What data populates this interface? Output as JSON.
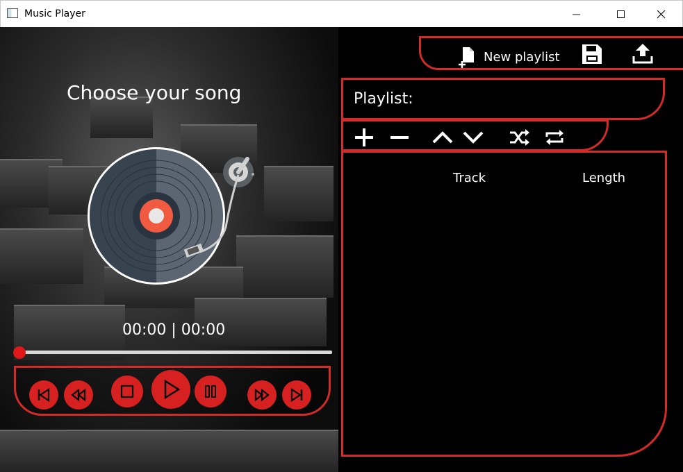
{
  "window": {
    "title": "Music Player",
    "icons": [
      "app-icon",
      "minimize-icon",
      "maximize-icon",
      "close-icon"
    ]
  },
  "player": {
    "heading": "Choose your song",
    "time_display": "00:00 | 00:00",
    "progress": 0,
    "controls": [
      "skip-back-icon",
      "rewind-icon",
      "stop-icon",
      "play-icon",
      "pause-icon",
      "fast-forward-icon",
      "skip-forward-icon"
    ]
  },
  "playlist_header": {
    "new_playlist_label": "New playlist",
    "icons": [
      "new-file-icon",
      "save-icon",
      "upload-icon"
    ]
  },
  "playlist": {
    "label": "Playlist:",
    "toolbar_icons": [
      "add-icon",
      "remove-icon",
      "move-up-icon",
      "move-down-icon",
      "shuffle-icon",
      "repeat-icon"
    ],
    "columns": [
      "Track",
      "Length"
    ],
    "rows": []
  },
  "colors": {
    "accent": "#d42a2a",
    "button": "#d72020",
    "background": "#000000",
    "text": "#ffffff"
  }
}
